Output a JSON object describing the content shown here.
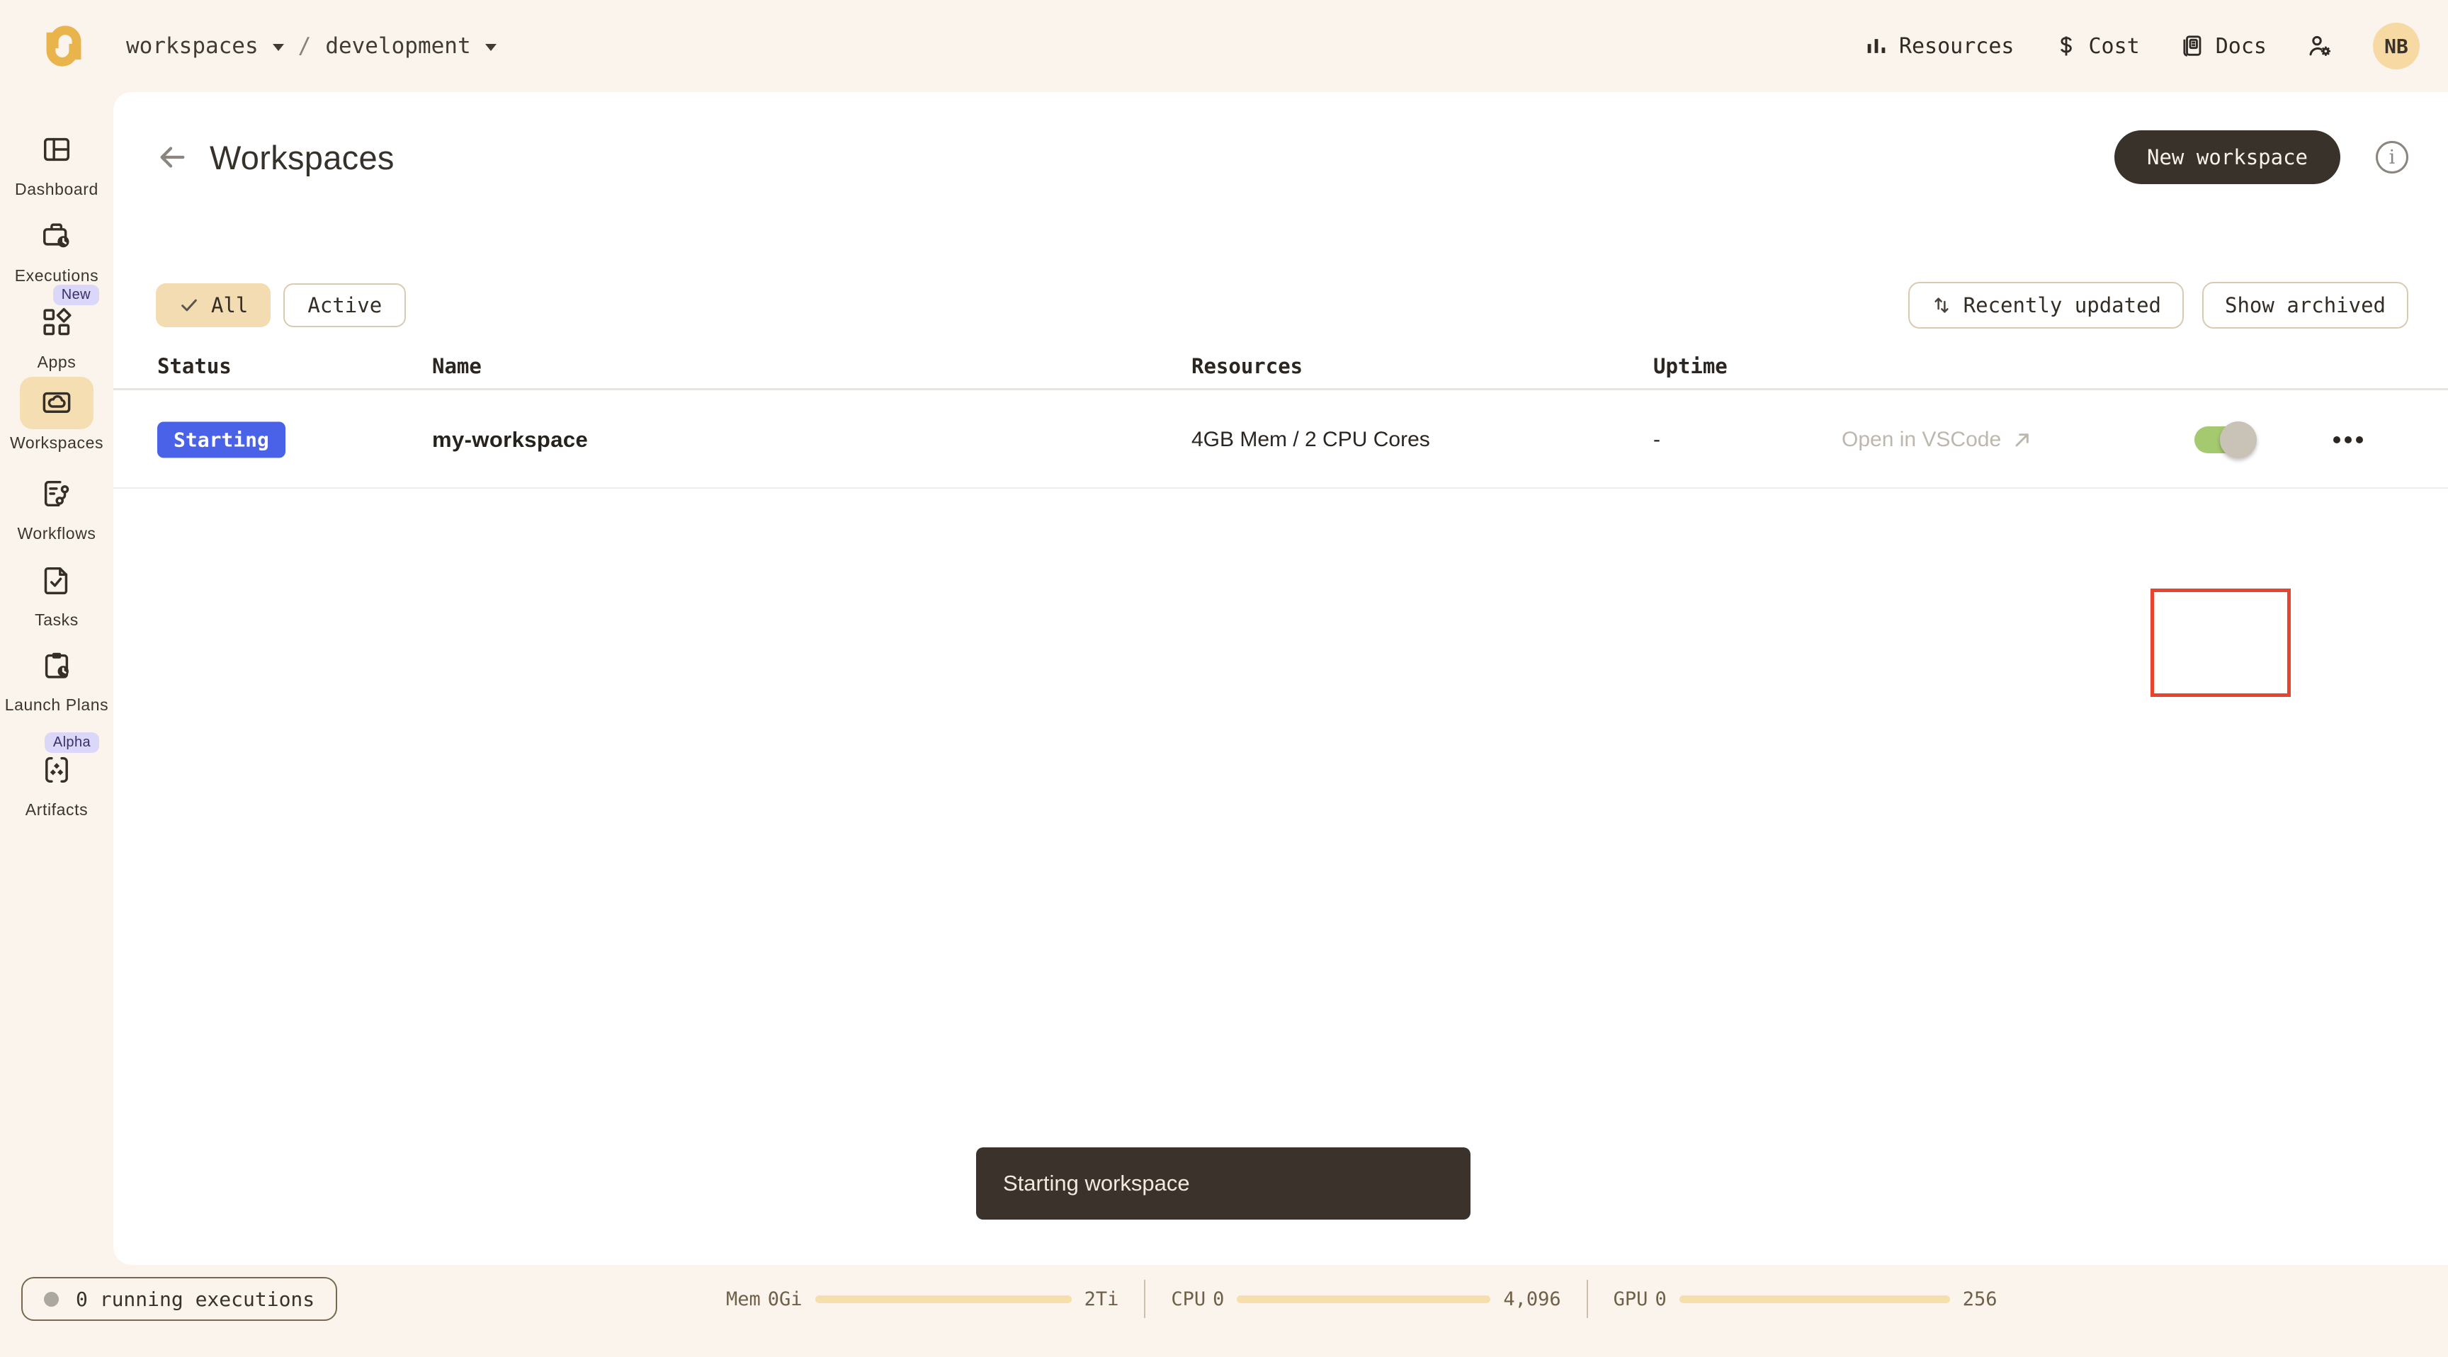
{
  "topbar": {
    "breadcrumb": {
      "workspace": "workspaces",
      "separator": "/",
      "project": "development"
    },
    "nav": [
      {
        "label": "Resources",
        "icon": "bar-chart-icon"
      },
      {
        "label": "Cost",
        "icon": "dollar-icon"
      },
      {
        "label": "Docs",
        "icon": "docs-icon"
      }
    ],
    "avatar_initials": "NB"
  },
  "sidebar": {
    "items": [
      {
        "label": "Dashboard"
      },
      {
        "label": "Executions"
      },
      {
        "label": "Apps",
        "badge": "New"
      },
      {
        "label": "Workspaces",
        "active": true
      },
      {
        "label": "Workflows"
      },
      {
        "label": "Tasks"
      },
      {
        "label": "Launch Plans"
      },
      {
        "label": "Artifacts",
        "badge": "Alpha"
      }
    ]
  },
  "page": {
    "title": "Workspaces",
    "new_workspace_button": "New workspace",
    "filter_all": "All",
    "filter_active": "Active",
    "sort_button": "Recently updated",
    "show_archived_button": "Show archived"
  },
  "table": {
    "headers": [
      "Status",
      "Name",
      "Resources",
      "Uptime"
    ],
    "row": {
      "status": "Starting",
      "name": "my-workspace",
      "resources": "4GB Mem / 2 CPU Cores",
      "uptime": "-",
      "vscode_link": "Open in VSCode",
      "toggle_on": true
    }
  },
  "toast": {
    "message": "Starting workspace"
  },
  "footer": {
    "running_executions": "0 running executions",
    "meters": [
      {
        "label": "Mem",
        "current": "0Gi",
        "max": "2Ti"
      },
      {
        "label": "CPU",
        "current": "0",
        "max": "4,096"
      },
      {
        "label": "GPU",
        "current": "0",
        "max": "256"
      }
    ]
  },
  "colors": {
    "background": "#FAF4EC",
    "panel": "#FFFFFF",
    "accent_gold": "#E9B44C",
    "active_item_bg": "#F5DEB2",
    "chip_bg": "#F3DCB2",
    "status_badge_blue": "#4A62E8",
    "badge_lavender": "#DBD7F8",
    "toggle_green": "#A5C96F",
    "toggle_knob_gray": "#C9C2B7",
    "annotation_red": "#E8432C",
    "toast_bg": "#3A322B",
    "meter_bar": "#F6DFAC",
    "button_dark": "#39322A"
  }
}
